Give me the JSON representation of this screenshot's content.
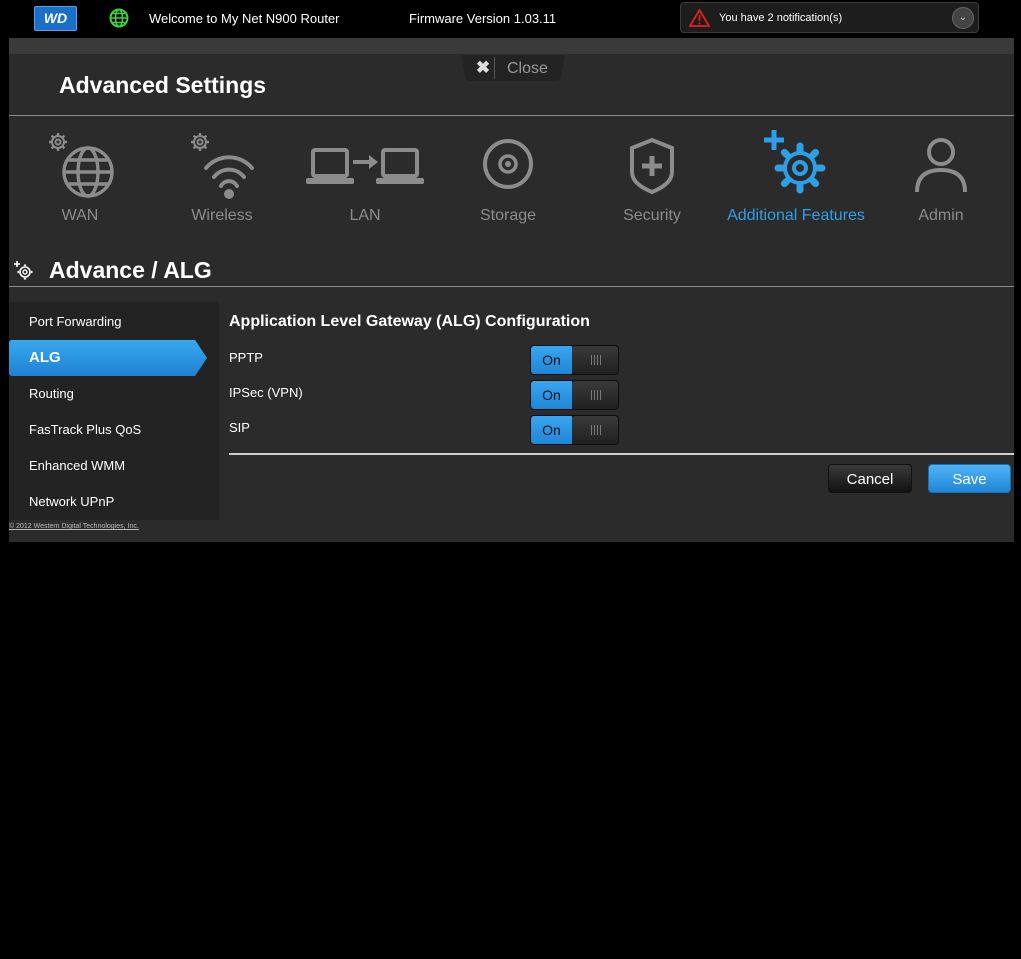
{
  "header": {
    "logo_text": "WD",
    "welcome": "Welcome to My Net N900 Router",
    "firmware": "Firmware Version 1.03.11",
    "notification": "You have 2 notification(s)"
  },
  "panel": {
    "close_label": "Close",
    "title": "Advanced Settings"
  },
  "categories": [
    {
      "label": "WAN"
    },
    {
      "label": "Wireless"
    },
    {
      "label": "LAN"
    },
    {
      "label": "Storage"
    },
    {
      "label": "Security"
    },
    {
      "label": "Additional Features"
    },
    {
      "label": "Admin"
    }
  ],
  "section": {
    "title": "Advance / ALG"
  },
  "sidemenu": [
    {
      "label": "Port Forwarding"
    },
    {
      "label": "ALG"
    },
    {
      "label": "Routing"
    },
    {
      "label": "FasTrack Plus QoS"
    },
    {
      "label": "Enhanced WMM"
    },
    {
      "label": "Network UPnP"
    }
  ],
  "content": {
    "title": "Application Level Gateway (ALG) Configuration",
    "rows": [
      {
        "label": "PPTP",
        "state": "On"
      },
      {
        "label": "IPSec (VPN)",
        "state": "On"
      },
      {
        "label": "SIP",
        "state": "On"
      }
    ],
    "cancel_label": "Cancel",
    "save_label": "Save"
  },
  "footer": {
    "copyright": "© 2012 Western Digital Technologies, Inc."
  },
  "colors": {
    "accent": "#2d9fe6",
    "inactive": "#8c8c8c",
    "panel": "#2b2b2b"
  }
}
